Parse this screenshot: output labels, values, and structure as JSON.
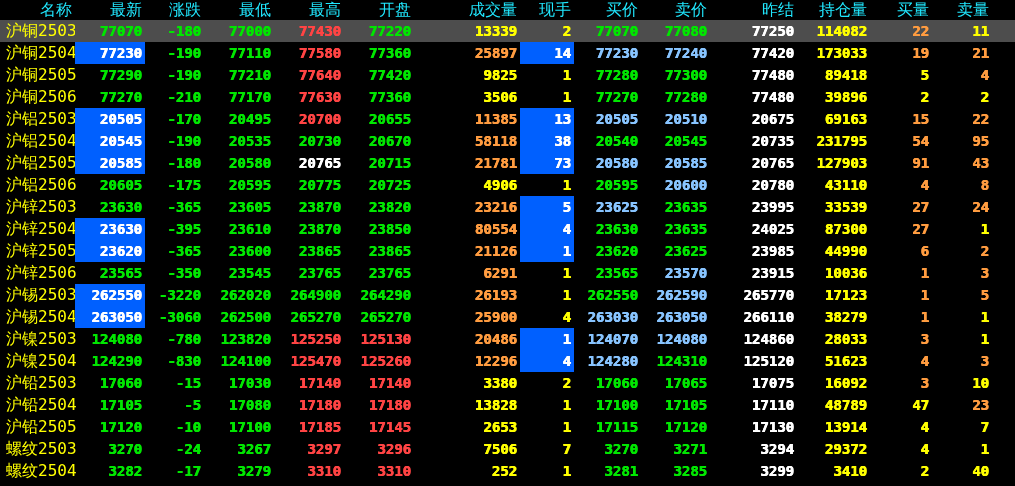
{
  "columns": [
    "名称",
    "最新",
    "涨跌",
    "最低",
    "最高",
    "开盘",
    "成交量",
    "现手",
    "买价",
    "卖价",
    "昨结",
    "持仓量",
    "买量",
    "卖量"
  ],
  "rows": [
    {
      "name": "沪铜2503",
      "selected": true,
      "last_highlighted": false,
      "qty_highlighted": false,
      "cells": [
        {
          "text": "77070",
          "color": "#00e600"
        },
        {
          "text": "-180",
          "color": "#00e600"
        },
        {
          "text": "77000",
          "color": "#00e600"
        },
        {
          "text": "77430",
          "color": "#ff4444"
        },
        {
          "text": "77220",
          "color": "#00e600"
        },
        {
          "text": "13339",
          "color": "#ffff00"
        },
        {
          "text": "2",
          "color": "#ffff00"
        },
        {
          "text": "77070",
          "color": "#00e600"
        },
        {
          "text": "77080",
          "color": "#00e600"
        },
        {
          "text": "77250",
          "color": "#ffffff"
        },
        {
          "text": "114082",
          "color": "#ffff00"
        },
        {
          "text": "22",
          "color": "#ff9c40"
        },
        {
          "text": "11",
          "color": "#ffff00"
        }
      ]
    },
    {
      "name": "沪铜2504",
      "selected": false,
      "last_highlighted": true,
      "qty_highlighted": true,
      "cells": [
        {
          "text": "77230",
          "color": "#ffffff"
        },
        {
          "text": "-190",
          "color": "#00e600"
        },
        {
          "text": "77110",
          "color": "#00e600"
        },
        {
          "text": "77580",
          "color": "#ff4444"
        },
        {
          "text": "77360",
          "color": "#00e600"
        },
        {
          "text": "25897",
          "color": "#ff9c40"
        },
        {
          "text": "14",
          "color": "#ffffff"
        },
        {
          "text": "77230",
          "color": "#88c4ff"
        },
        {
          "text": "77240",
          "color": "#88c4ff"
        },
        {
          "text": "77420",
          "color": "#ffffff"
        },
        {
          "text": "173033",
          "color": "#ffff00"
        },
        {
          "text": "19",
          "color": "#ff9c40"
        },
        {
          "text": "21",
          "color": "#ff9c40"
        }
      ]
    },
    {
      "name": "沪铜2505",
      "selected": false,
      "last_highlighted": false,
      "qty_highlighted": false,
      "cells": [
        {
          "text": "77290",
          "color": "#00e600"
        },
        {
          "text": "-190",
          "color": "#00e600"
        },
        {
          "text": "77210",
          "color": "#00e600"
        },
        {
          "text": "77640",
          "color": "#ff4444"
        },
        {
          "text": "77420",
          "color": "#00e600"
        },
        {
          "text": "9825",
          "color": "#ffff00"
        },
        {
          "text": "1",
          "color": "#ffff00"
        },
        {
          "text": "77280",
          "color": "#00e600"
        },
        {
          "text": "77300",
          "color": "#00e600"
        },
        {
          "text": "77480",
          "color": "#ffffff"
        },
        {
          "text": "89418",
          "color": "#ffff00"
        },
        {
          "text": "5",
          "color": "#ffff00"
        },
        {
          "text": "4",
          "color": "#ff9c40"
        }
      ]
    },
    {
      "name": "沪铜2506",
      "selected": false,
      "last_highlighted": false,
      "qty_highlighted": false,
      "cells": [
        {
          "text": "77270",
          "color": "#00e600"
        },
        {
          "text": "-210",
          "color": "#00e600"
        },
        {
          "text": "77170",
          "color": "#00e600"
        },
        {
          "text": "77630",
          "color": "#ff4444"
        },
        {
          "text": "77360",
          "color": "#00e600"
        },
        {
          "text": "3506",
          "color": "#ffff00"
        },
        {
          "text": "1",
          "color": "#ffff00"
        },
        {
          "text": "77270",
          "color": "#00e600"
        },
        {
          "text": "77280",
          "color": "#00e600"
        },
        {
          "text": "77480",
          "color": "#ffffff"
        },
        {
          "text": "39896",
          "color": "#ffff00"
        },
        {
          "text": "2",
          "color": "#ffff00"
        },
        {
          "text": "2",
          "color": "#ffff00"
        }
      ]
    },
    {
      "name": "沪铝2503",
      "selected": false,
      "last_highlighted": true,
      "qty_highlighted": true,
      "cells": [
        {
          "text": "20505",
          "color": "#ffffff"
        },
        {
          "text": "-170",
          "color": "#00e600"
        },
        {
          "text": "20495",
          "color": "#00e600"
        },
        {
          "text": "20700",
          "color": "#ff4444"
        },
        {
          "text": "20655",
          "color": "#00e600"
        },
        {
          "text": "11385",
          "color": "#ff9c40"
        },
        {
          "text": "13",
          "color": "#ffffff"
        },
        {
          "text": "20505",
          "color": "#88c4ff"
        },
        {
          "text": "20510",
          "color": "#88c4ff"
        },
        {
          "text": "20675",
          "color": "#ffffff"
        },
        {
          "text": "69163",
          "color": "#ffff00"
        },
        {
          "text": "15",
          "color": "#ff9c40"
        },
        {
          "text": "22",
          "color": "#ff9c40"
        }
      ]
    },
    {
      "name": "沪铝2504",
      "selected": false,
      "last_highlighted": true,
      "qty_highlighted": true,
      "cells": [
        {
          "text": "20545",
          "color": "#ffffff"
        },
        {
          "text": "-190",
          "color": "#00e600"
        },
        {
          "text": "20535",
          "color": "#00e600"
        },
        {
          "text": "20730",
          "color": "#00e600"
        },
        {
          "text": "20670",
          "color": "#00e600"
        },
        {
          "text": "58118",
          "color": "#ff9c40"
        },
        {
          "text": "38",
          "color": "#ffffff"
        },
        {
          "text": "20540",
          "color": "#00e600"
        },
        {
          "text": "20545",
          "color": "#00e600"
        },
        {
          "text": "20735",
          "color": "#ffffff"
        },
        {
          "text": "231795",
          "color": "#ffff00"
        },
        {
          "text": "54",
          "color": "#ff9c40"
        },
        {
          "text": "95",
          "color": "#ff9c40"
        }
      ]
    },
    {
      "name": "沪铝2505",
      "selected": false,
      "last_highlighted": true,
      "qty_highlighted": true,
      "cells": [
        {
          "text": "20585",
          "color": "#ffffff"
        },
        {
          "text": "-180",
          "color": "#00e600"
        },
        {
          "text": "20580",
          "color": "#00e600"
        },
        {
          "text": "20765",
          "color": "#ffffff"
        },
        {
          "text": "20715",
          "color": "#00e600"
        },
        {
          "text": "21781",
          "color": "#ff9c40"
        },
        {
          "text": "73",
          "color": "#ffffff"
        },
        {
          "text": "20580",
          "color": "#88c4ff"
        },
        {
          "text": "20585",
          "color": "#88c4ff"
        },
        {
          "text": "20765",
          "color": "#ffffff"
        },
        {
          "text": "127903",
          "color": "#ffff00"
        },
        {
          "text": "91",
          "color": "#ff9c40"
        },
        {
          "text": "43",
          "color": "#ff9c40"
        }
      ]
    },
    {
      "name": "沪铝2506",
      "selected": false,
      "last_highlighted": false,
      "qty_highlighted": false,
      "cells": [
        {
          "text": "20605",
          "color": "#00e600"
        },
        {
          "text": "-175",
          "color": "#00e600"
        },
        {
          "text": "20595",
          "color": "#00e600"
        },
        {
          "text": "20775",
          "color": "#00e600"
        },
        {
          "text": "20725",
          "color": "#00e600"
        },
        {
          "text": "4906",
          "color": "#ffff00"
        },
        {
          "text": "1",
          "color": "#ffff00"
        },
        {
          "text": "20595",
          "color": "#00e600"
        },
        {
          "text": "20600",
          "color": "#88c4ff"
        },
        {
          "text": "20780",
          "color": "#ffffff"
        },
        {
          "text": "43110",
          "color": "#ffff00"
        },
        {
          "text": "4",
          "color": "#ff9c40"
        },
        {
          "text": "8",
          "color": "#ff9c40"
        }
      ]
    },
    {
      "name": "沪锌2503",
      "selected": false,
      "last_highlighted": false,
      "qty_highlighted": true,
      "cells": [
        {
          "text": "23630",
          "color": "#00e600"
        },
        {
          "text": "-365",
          "color": "#00e600"
        },
        {
          "text": "23605",
          "color": "#00e600"
        },
        {
          "text": "23870",
          "color": "#00e600"
        },
        {
          "text": "23820",
          "color": "#00e600"
        },
        {
          "text": "23216",
          "color": "#ff9c40"
        },
        {
          "text": "5",
          "color": "#ffffff"
        },
        {
          "text": "23625",
          "color": "#88c4ff"
        },
        {
          "text": "23635",
          "color": "#00e600"
        },
        {
          "text": "23995",
          "color": "#ffffff"
        },
        {
          "text": "33539",
          "color": "#ffff00"
        },
        {
          "text": "27",
          "color": "#ff9c40"
        },
        {
          "text": "24",
          "color": "#ff9c40"
        }
      ]
    },
    {
      "name": "沪锌2504",
      "selected": false,
      "last_highlighted": true,
      "qty_highlighted": true,
      "cells": [
        {
          "text": "23630",
          "color": "#ffffff"
        },
        {
          "text": "-395",
          "color": "#00e600"
        },
        {
          "text": "23610",
          "color": "#00e600"
        },
        {
          "text": "23870",
          "color": "#00e600"
        },
        {
          "text": "23850",
          "color": "#00e600"
        },
        {
          "text": "80554",
          "color": "#ff9c40"
        },
        {
          "text": "4",
          "color": "#ffffff"
        },
        {
          "text": "23630",
          "color": "#00e600"
        },
        {
          "text": "23635",
          "color": "#00e600"
        },
        {
          "text": "24025",
          "color": "#ffffff"
        },
        {
          "text": "87300",
          "color": "#ffff00"
        },
        {
          "text": "27",
          "color": "#ff9c40"
        },
        {
          "text": "1",
          "color": "#ffff00"
        }
      ]
    },
    {
      "name": "沪锌2505",
      "selected": false,
      "last_highlighted": true,
      "qty_highlighted": true,
      "cells": [
        {
          "text": "23620",
          "color": "#ffffff"
        },
        {
          "text": "-365",
          "color": "#00e600"
        },
        {
          "text": "23600",
          "color": "#00e600"
        },
        {
          "text": "23865",
          "color": "#00e600"
        },
        {
          "text": "23865",
          "color": "#00e600"
        },
        {
          "text": "21126",
          "color": "#ff9c40"
        },
        {
          "text": "1",
          "color": "#ffffff"
        },
        {
          "text": "23620",
          "color": "#00e600"
        },
        {
          "text": "23625",
          "color": "#00e600"
        },
        {
          "text": "23985",
          "color": "#ffffff"
        },
        {
          "text": "44990",
          "color": "#ffff00"
        },
        {
          "text": "6",
          "color": "#ff9c40"
        },
        {
          "text": "2",
          "color": "#ff9c40"
        }
      ]
    },
    {
      "name": "沪锌2506",
      "selected": false,
      "last_highlighted": false,
      "qty_highlighted": false,
      "cells": [
        {
          "text": "23565",
          "color": "#00e600"
        },
        {
          "text": "-350",
          "color": "#00e600"
        },
        {
          "text": "23545",
          "color": "#00e600"
        },
        {
          "text": "23765",
          "color": "#00e600"
        },
        {
          "text": "23765",
          "color": "#00e600"
        },
        {
          "text": "6291",
          "color": "#ff9c40"
        },
        {
          "text": "1",
          "color": "#ffff00"
        },
        {
          "text": "23565",
          "color": "#00e600"
        },
        {
          "text": "23570",
          "color": "#88c4ff"
        },
        {
          "text": "23915",
          "color": "#ffffff"
        },
        {
          "text": "10036",
          "color": "#ffff00"
        },
        {
          "text": "1",
          "color": "#ff9c40"
        },
        {
          "text": "3",
          "color": "#ff9c40"
        }
      ]
    },
    {
      "name": "沪锡2503",
      "selected": false,
      "last_highlighted": true,
      "qty_highlighted": false,
      "cells": [
        {
          "text": "262550",
          "color": "#ffffff"
        },
        {
          "text": "-3220",
          "color": "#00e600"
        },
        {
          "text": "262020",
          "color": "#00e600"
        },
        {
          "text": "264900",
          "color": "#00e600"
        },
        {
          "text": "264290",
          "color": "#00e600"
        },
        {
          "text": "26193",
          "color": "#ff9c40"
        },
        {
          "text": "1",
          "color": "#ffff00"
        },
        {
          "text": "262550",
          "color": "#00e600"
        },
        {
          "text": "262590",
          "color": "#88c4ff"
        },
        {
          "text": "265770",
          "color": "#ffffff"
        },
        {
          "text": "17123",
          "color": "#ffff00"
        },
        {
          "text": "1",
          "color": "#ff9c40"
        },
        {
          "text": "5",
          "color": "#ff9c40"
        }
      ]
    },
    {
      "name": "沪锡2504",
      "selected": false,
      "last_highlighted": true,
      "qty_highlighted": false,
      "cells": [
        {
          "text": "263050",
          "color": "#ffffff"
        },
        {
          "text": "-3060",
          "color": "#00e600"
        },
        {
          "text": "262500",
          "color": "#00e600"
        },
        {
          "text": "265270",
          "color": "#00e600"
        },
        {
          "text": "265270",
          "color": "#00e600"
        },
        {
          "text": "25900",
          "color": "#ff9c40"
        },
        {
          "text": "4",
          "color": "#ffff00"
        },
        {
          "text": "263030",
          "color": "#88c4ff"
        },
        {
          "text": "263050",
          "color": "#88c4ff"
        },
        {
          "text": "266110",
          "color": "#ffffff"
        },
        {
          "text": "38279",
          "color": "#ffff00"
        },
        {
          "text": "1",
          "color": "#ff9c40"
        },
        {
          "text": "1",
          "color": "#ffff00"
        }
      ]
    },
    {
      "name": "沪镍2503",
      "selected": false,
      "last_highlighted": false,
      "qty_highlighted": true,
      "cells": [
        {
          "text": "124080",
          "color": "#00e600"
        },
        {
          "text": "-780",
          "color": "#00e600"
        },
        {
          "text": "123820",
          "color": "#00e600"
        },
        {
          "text": "125250",
          "color": "#ff4444"
        },
        {
          "text": "125130",
          "color": "#ff4444"
        },
        {
          "text": "20486",
          "color": "#ff9c40"
        },
        {
          "text": "1",
          "color": "#ffffff"
        },
        {
          "text": "124070",
          "color": "#88c4ff"
        },
        {
          "text": "124080",
          "color": "#88c4ff"
        },
        {
          "text": "124860",
          "color": "#ffffff"
        },
        {
          "text": "28033",
          "color": "#ffff00"
        },
        {
          "text": "3",
          "color": "#ff9c40"
        },
        {
          "text": "1",
          "color": "#ffff00"
        }
      ]
    },
    {
      "name": "沪镍2504",
      "selected": false,
      "last_highlighted": false,
      "qty_highlighted": true,
      "cells": [
        {
          "text": "124290",
          "color": "#00e600"
        },
        {
          "text": "-830",
          "color": "#00e600"
        },
        {
          "text": "124100",
          "color": "#00e600"
        },
        {
          "text": "125470",
          "color": "#ff4444"
        },
        {
          "text": "125260",
          "color": "#ff4444"
        },
        {
          "text": "12296",
          "color": "#ff9c40"
        },
        {
          "text": "4",
          "color": "#ffffff"
        },
        {
          "text": "124280",
          "color": "#88c4ff"
        },
        {
          "text": "124310",
          "color": "#00e600"
        },
        {
          "text": "125120",
          "color": "#ffffff"
        },
        {
          "text": "51623",
          "color": "#ffff00"
        },
        {
          "text": "4",
          "color": "#ff9c40"
        },
        {
          "text": "3",
          "color": "#ff9c40"
        }
      ]
    },
    {
      "name": "沪铅2503",
      "selected": false,
      "last_highlighted": false,
      "qty_highlighted": false,
      "cells": [
        {
          "text": "17060",
          "color": "#00e600"
        },
        {
          "text": "-15",
          "color": "#00e600"
        },
        {
          "text": "17030",
          "color": "#00e600"
        },
        {
          "text": "17140",
          "color": "#ff4444"
        },
        {
          "text": "17140",
          "color": "#ff4444"
        },
        {
          "text": "3380",
          "color": "#ffff00"
        },
        {
          "text": "2",
          "color": "#ffff00"
        },
        {
          "text": "17060",
          "color": "#00e600"
        },
        {
          "text": "17065",
          "color": "#00e600"
        },
        {
          "text": "17075",
          "color": "#ffffff"
        },
        {
          "text": "16092",
          "color": "#ffff00"
        },
        {
          "text": "3",
          "color": "#ff9c40"
        },
        {
          "text": "10",
          "color": "#ffff00"
        }
      ]
    },
    {
      "name": "沪铅2504",
      "selected": false,
      "last_highlighted": false,
      "qty_highlighted": false,
      "cells": [
        {
          "text": "17105",
          "color": "#00e600"
        },
        {
          "text": "-5",
          "color": "#00e600"
        },
        {
          "text": "17080",
          "color": "#00e600"
        },
        {
          "text": "17180",
          "color": "#ff4444"
        },
        {
          "text": "17180",
          "color": "#ff4444"
        },
        {
          "text": "13828",
          "color": "#ffff00"
        },
        {
          "text": "1",
          "color": "#ffff00"
        },
        {
          "text": "17100",
          "color": "#00e600"
        },
        {
          "text": "17105",
          "color": "#00e600"
        },
        {
          "text": "17110",
          "color": "#ffffff"
        },
        {
          "text": "48789",
          "color": "#ffff00"
        },
        {
          "text": "47",
          "color": "#ffff00"
        },
        {
          "text": "23",
          "color": "#ff9c40"
        }
      ]
    },
    {
      "name": "沪铅2505",
      "selected": false,
      "last_highlighted": false,
      "qty_highlighted": false,
      "cells": [
        {
          "text": "17120",
          "color": "#00e600"
        },
        {
          "text": "-10",
          "color": "#00e600"
        },
        {
          "text": "17100",
          "color": "#00e600"
        },
        {
          "text": "17185",
          "color": "#ff4444"
        },
        {
          "text": "17145",
          "color": "#ff4444"
        },
        {
          "text": "2653",
          "color": "#ffff00"
        },
        {
          "text": "1",
          "color": "#ffff00"
        },
        {
          "text": "17115",
          "color": "#00e600"
        },
        {
          "text": "17120",
          "color": "#00e600"
        },
        {
          "text": "17130",
          "color": "#ffffff"
        },
        {
          "text": "13914",
          "color": "#ffff00"
        },
        {
          "text": "4",
          "color": "#ffff00"
        },
        {
          "text": "7",
          "color": "#ffff00"
        }
      ]
    },
    {
      "name": "螺纹2503",
      "selected": false,
      "last_highlighted": false,
      "qty_highlighted": false,
      "cells": [
        {
          "text": "3270",
          "color": "#00e600"
        },
        {
          "text": "-24",
          "color": "#00e600"
        },
        {
          "text": "3267",
          "color": "#00e600"
        },
        {
          "text": "3297",
          "color": "#ff4444"
        },
        {
          "text": "3296",
          "color": "#ff4444"
        },
        {
          "text": "7506",
          "color": "#ffff00"
        },
        {
          "text": "7",
          "color": "#ffff00"
        },
        {
          "text": "3270",
          "color": "#00e600"
        },
        {
          "text": "3271",
          "color": "#00e600"
        },
        {
          "text": "3294",
          "color": "#ffffff"
        },
        {
          "text": "29372",
          "color": "#ffff00"
        },
        {
          "text": "4",
          "color": "#ffff00"
        },
        {
          "text": "1",
          "color": "#ffff00"
        }
      ]
    },
    {
      "name": "螺纹2504",
      "selected": false,
      "last_highlighted": false,
      "qty_highlighted": false,
      "cells": [
        {
          "text": "3282",
          "color": "#00e600"
        },
        {
          "text": "-17",
          "color": "#00e600"
        },
        {
          "text": "3279",
          "color": "#00e600"
        },
        {
          "text": "3310",
          "color": "#ff4444"
        },
        {
          "text": "3310",
          "color": "#ff4444"
        },
        {
          "text": "252",
          "color": "#ffff00"
        },
        {
          "text": "1",
          "color": "#ffff00"
        },
        {
          "text": "3281",
          "color": "#00e600"
        },
        {
          "text": "3285",
          "color": "#00e600"
        },
        {
          "text": "3299",
          "color": "#ffffff"
        },
        {
          "text": "3410",
          "color": "#ffff00"
        },
        {
          "text": "2",
          "color": "#ffff00"
        },
        {
          "text": "40",
          "color": "#ffff00"
        }
      ]
    }
  ]
}
